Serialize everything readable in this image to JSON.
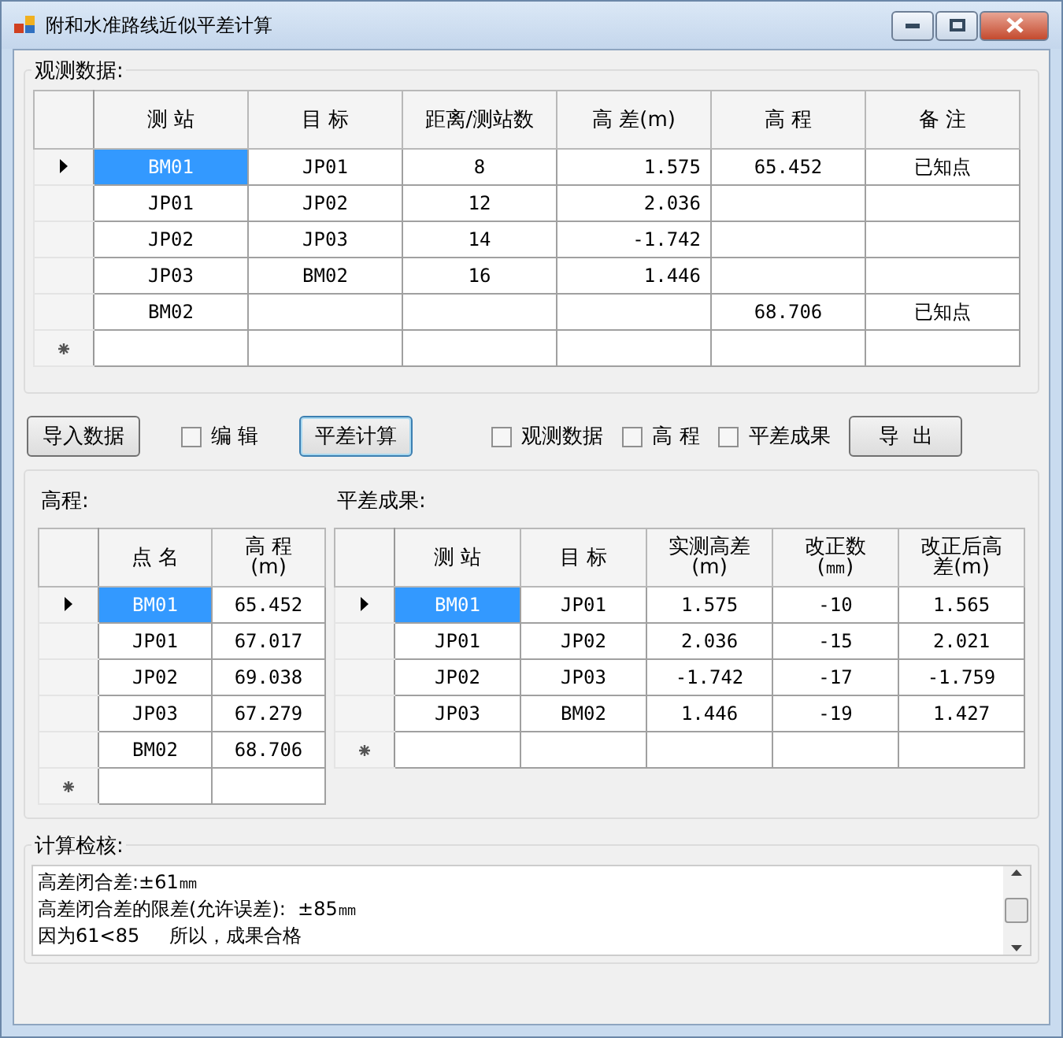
{
  "window": {
    "title": "附和水准路线近似平差计算"
  },
  "observation": {
    "label": "观测数据:",
    "columns": [
      "测 站",
      "目 标",
      "距离/测站数",
      "高 差(m)",
      "高 程",
      "备 注"
    ],
    "rows": [
      {
        "kind": "data",
        "selected": true,
        "cells": [
          "BM01",
          "JP01",
          "8",
          "1.575",
          "65.452",
          "已知点"
        ]
      },
      {
        "kind": "data",
        "selected": false,
        "cells": [
          "JP01",
          "JP02",
          "12",
          "2.036",
          null,
          null
        ]
      },
      {
        "kind": "data",
        "selected": false,
        "cells": [
          "JP02",
          "JP03",
          "14",
          "-1.742",
          null,
          null
        ]
      },
      {
        "kind": "data",
        "selected": false,
        "cells": [
          "JP03",
          "BM02",
          "16",
          "1.446",
          null,
          null
        ]
      },
      {
        "kind": "data",
        "selected": false,
        "cells": [
          "BM02",
          null,
          null,
          null,
          "68.706",
          "已知点"
        ]
      },
      {
        "kind": "new",
        "selected": false
      }
    ]
  },
  "controls": [
    {
      "kind": "button",
      "label": "导入数据",
      "focused": false
    },
    {
      "kind": "checkbox",
      "label": "编 辑",
      "checked": false
    },
    {
      "kind": "button",
      "label": "平差计算",
      "focused": true
    },
    {
      "kind": "checkbox",
      "label": "观测数据",
      "checked": false
    },
    {
      "kind": "checkbox",
      "label": "高 程",
      "checked": false
    },
    {
      "kind": "checkbox",
      "label": "平差成果",
      "checked": false
    },
    {
      "kind": "button",
      "label": "导  出",
      "focused": false
    }
  ],
  "elevation": {
    "label": "高程:",
    "columns": [
      "点 名",
      "高 程(m)"
    ],
    "rows": [
      {
        "kind": "data",
        "selected": true,
        "cells": [
          "BM01",
          "65.452"
        ]
      },
      {
        "kind": "data",
        "selected": false,
        "cells": [
          "JP01",
          "67.017"
        ]
      },
      {
        "kind": "data",
        "selected": false,
        "cells": [
          "JP02",
          "69.038"
        ]
      },
      {
        "kind": "data",
        "selected": false,
        "cells": [
          "JP03",
          "67.279"
        ]
      },
      {
        "kind": "data",
        "selected": false,
        "cells": [
          "BM02",
          "68.706"
        ]
      },
      {
        "kind": "new",
        "selected": false
      }
    ]
  },
  "adjustment": {
    "label": "平差成果:",
    "columns": [
      "测 站",
      "目 标",
      "实测高差(m)",
      "改正数(㎜)",
      "改正后高差(m)"
    ],
    "rows": [
      {
        "kind": "data",
        "selected": true,
        "cells": [
          "BM01",
          "JP01",
          "1.575",
          "-10",
          "1.565"
        ]
      },
      {
        "kind": "data",
        "selected": false,
        "cells": [
          "JP01",
          "JP02",
          "2.036",
          "-15",
          "2.021"
        ]
      },
      {
        "kind": "data",
        "selected": false,
        "cells": [
          "JP02",
          "JP03",
          "-1.742",
          "-17",
          "-1.759"
        ]
      },
      {
        "kind": "data",
        "selected": false,
        "cells": [
          "JP03",
          "BM02",
          "1.446",
          "-19",
          "1.427"
        ]
      },
      {
        "kind": "new",
        "selected": false
      }
    ]
  },
  "check": {
    "label": "计算检核:",
    "lines": [
      "高差闭合差:±61㎜",
      "高差闭合差的限差(允许误差):  ±85㎜",
      "因为61<85     所以，成果合格"
    ]
  }
}
